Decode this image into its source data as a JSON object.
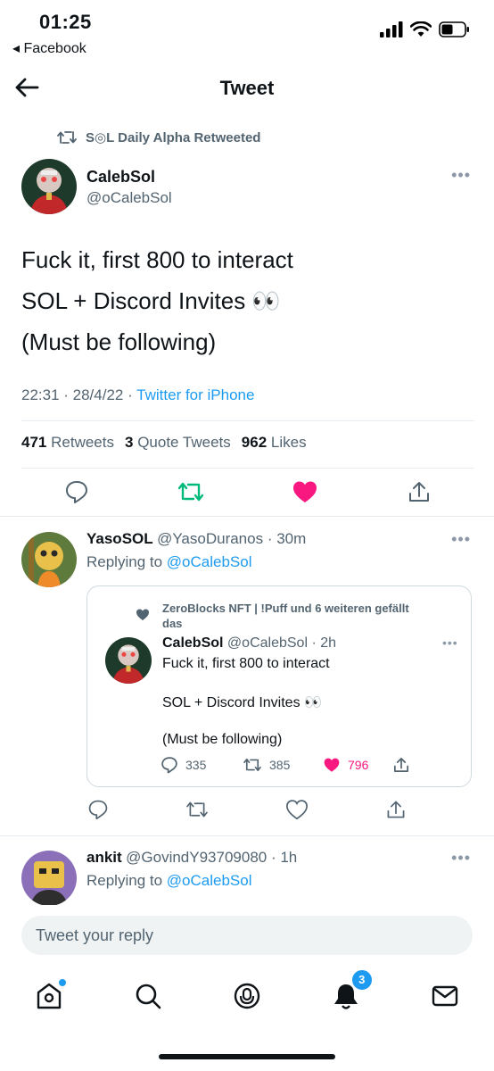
{
  "status_bar": {
    "time": "01:25",
    "back_app": "◂ Facebook"
  },
  "header": {
    "title": "Tweet"
  },
  "retweet_context": "S◎L Daily Alpha Retweeted",
  "tweet": {
    "author_name": "CalebSol",
    "author_handle": "@oCalebSol",
    "lines": [
      "Fuck it, first 800 to interact",
      "SOL + Discord Invites 👀",
      "(Must be following)"
    ],
    "time": "22:31 · 28/4/22 · ",
    "source": "Twitter for iPhone",
    "retweets": "471",
    "retweets_label": "Retweets",
    "quotes": "3",
    "quotes_label": "Quote Tweets",
    "likes": "962",
    "likes_label": "Likes"
  },
  "replies": [
    {
      "name": "YasoSOL",
      "handle": "@YasoDuranos · 30m",
      "replying_prefix": "Replying to ",
      "replying_to": "@oCalebSol",
      "quote": {
        "liked_by": "ZeroBlocks NFT | !Puff und 6 weiteren gefällt das",
        "name": "CalebSol",
        "handle": "@oCalebSol · 2h",
        "line1": "Fuck it, first 800 to interact",
        "line2": "SOL + Discord Invites 👀",
        "line3": "(Must be following)",
        "replies": "335",
        "retweets": "385",
        "likes": "796"
      }
    },
    {
      "name": "ankit",
      "handle": "@GovindY93709080 · 1h",
      "replying_prefix": "Replying to ",
      "replying_to": "@oCalebSol"
    }
  ],
  "reply_input": {
    "placeholder": "Tweet your reply"
  },
  "bottom_nav": {
    "notifications_badge": "3"
  },
  "colors": {
    "accent": "#1d9bf0",
    "like": "#f91880",
    "retweet": "#00ba7c"
  }
}
